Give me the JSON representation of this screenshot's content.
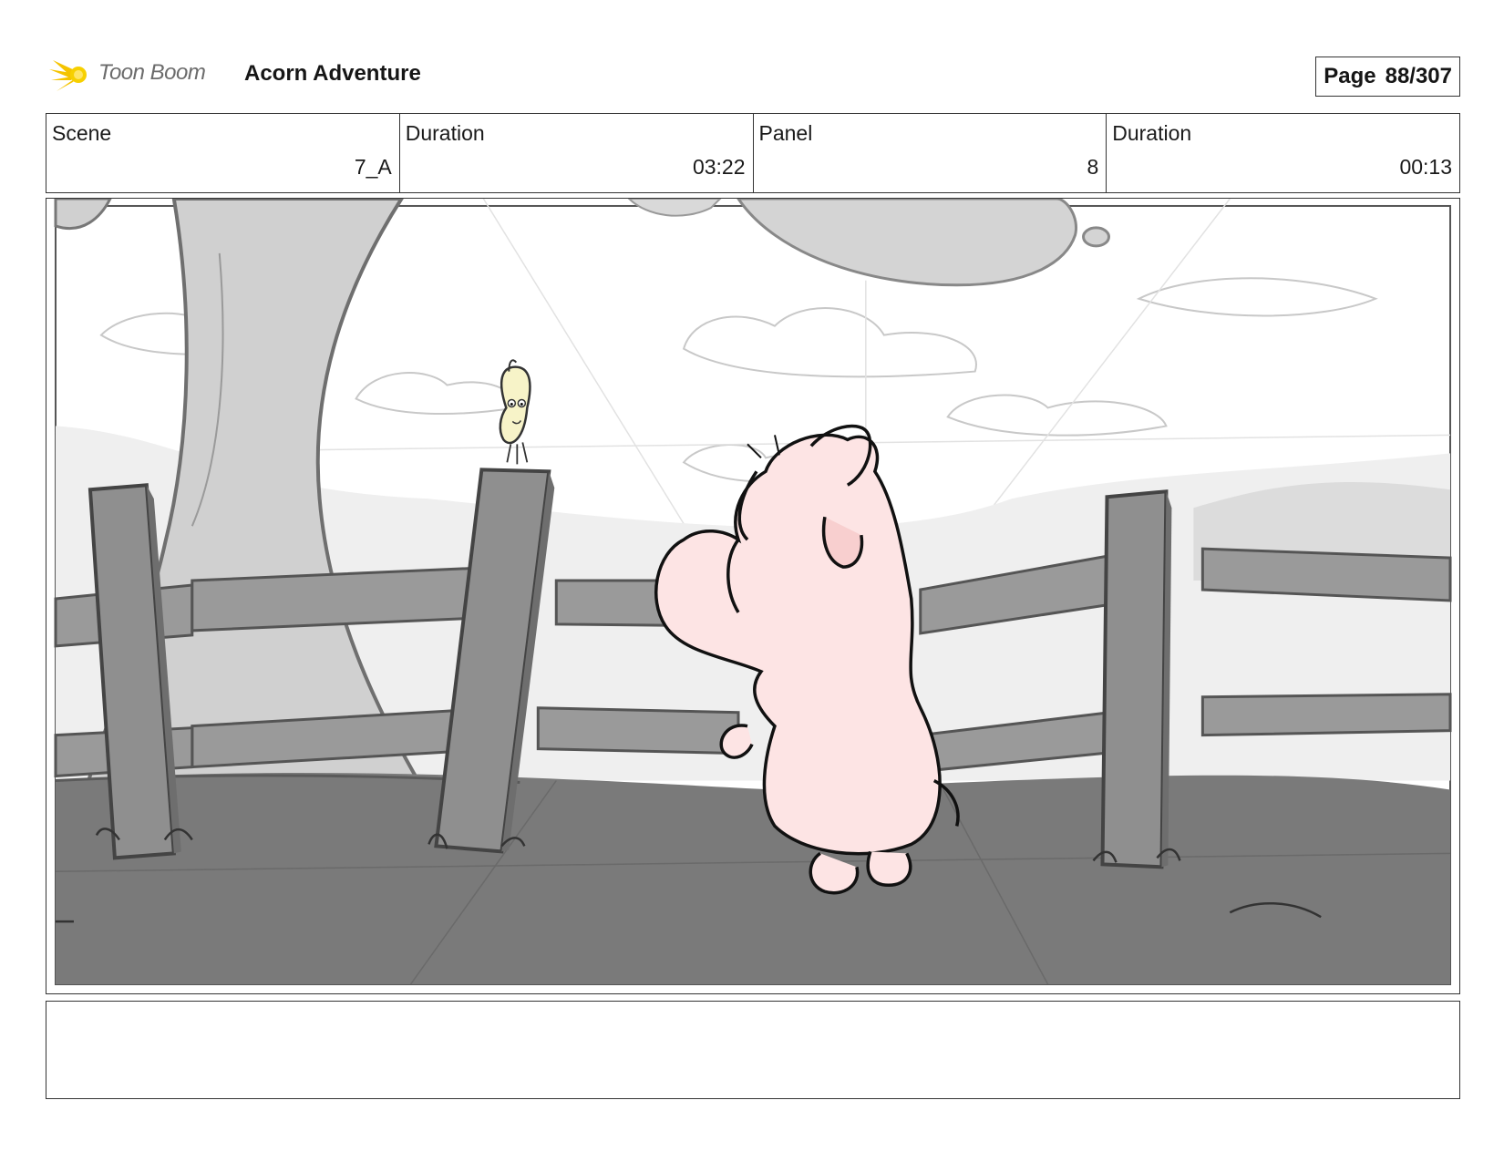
{
  "header": {
    "brand_name": "Toon Boom",
    "project_title": "Acorn Adventure",
    "page_label": "Page",
    "page_number": "88/307"
  },
  "info": [
    {
      "label": "Scene",
      "value": "7_A"
    },
    {
      "label": "Duration",
      "value": "03:22"
    },
    {
      "label": "Panel",
      "value": "8"
    },
    {
      "label": "Duration",
      "value": "00:13"
    }
  ],
  "panel": {
    "image": "storyboard-sketch: pink creature looking over a wooden fence at a small yellow acorn character perched on a fence post, tree on the left, cloudy sky"
  },
  "notes": {
    "text": ""
  },
  "colors": {
    "creature_pink": "#fde4e4",
    "acorn_yellow": "#f7f3c8",
    "fence_gray": "#8f8f8f",
    "ground_gray": "#7a7a7a",
    "logo_yellow": "#f5c400"
  }
}
